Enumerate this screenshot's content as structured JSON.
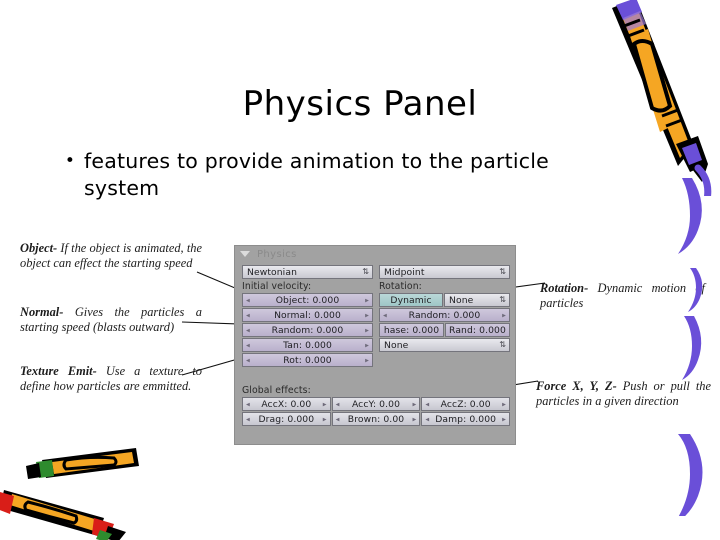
{
  "slide": {
    "title": "Physics Panel",
    "bullets": [
      {
        "marker": "•",
        "text": "features to provide animation to the particle system"
      }
    ]
  },
  "annotations": {
    "left": [
      {
        "name": "object",
        "term": "Object-",
        "body": "If the object is animated, the object can effect the starting speed"
      },
      {
        "name": "normal",
        "term": "Normal-",
        "body": "Gives the particles a starting speed (blasts  outward)"
      },
      {
        "name": "texture-emit",
        "term": "Texture Emit-",
        "body": "Use a texture to define how particles are emmitted."
      }
    ],
    "right": [
      {
        "name": "rotation",
        "term": "Rotation-",
        "body": "Dynamic motion of particles"
      },
      {
        "name": "force-xyz",
        "term": "Force X, Y, Z-",
        "body": "Push or pull the particles in a given direction"
      }
    ]
  },
  "physics_panel": {
    "header": {
      "title": "Physics",
      "collapse_icon": "triangle-down-icon"
    },
    "left_column": {
      "type_menu": {
        "value": "Newtonian",
        "arrows_icon": "updown-arrows-icon"
      },
      "section_label": "Initial velocity:",
      "sliders": [
        {
          "label": "Object: 0.000"
        },
        {
          "label": "Normal: 0.000"
        },
        {
          "label": "Random: 0.000"
        },
        {
          "label": "Tan: 0.000"
        },
        {
          "label": "Rot: 0.000"
        }
      ]
    },
    "right_column": {
      "integrator_menu": {
        "value": "Midpoint",
        "arrows_icon": "updown-arrows-icon"
      },
      "section_label": "Rotation:",
      "dynamic_toggle": {
        "label": "Dynamic",
        "active": true
      },
      "rotation_menu": {
        "value": "None",
        "arrows_icon": "updown-arrows-icon"
      },
      "random_slider": {
        "label": "Random: 0.000"
      },
      "phase_pair": [
        {
          "label": "hase: 0.000"
        },
        {
          "label": "Rand: 0.000"
        }
      ],
      "bottom_menu": {
        "value": "None",
        "arrows_icon": "updown-arrows-icon"
      }
    },
    "global_effects": {
      "section_label": "Global effects:",
      "row1": [
        {
          "label": "AccX: 0.00"
        },
        {
          "label": "AccY: 0.00"
        },
        {
          "label": "AccZ: 0.00"
        }
      ],
      "row2": [
        {
          "label": "Drag: 0.000"
        },
        {
          "label": "Brown: 0.00"
        },
        {
          "label": "Damp: 0.000"
        }
      ]
    },
    "arrow_icons": {
      "left": "◂",
      "right": "▸",
      "updown": "⇅"
    }
  },
  "decorations": {
    "crayon_top_right": {
      "name": "yellow-crayon-icon",
      "body_color": "#F5A623",
      "outline_color": "#000000",
      "tip_color": "#6A4FD8"
    },
    "crayons_bottom_left": {
      "name": "crossed-crayons-icon",
      "body_color": "#F5A623",
      "tip_color": "#D91E18",
      "accent_color": "#2E8B2E"
    },
    "swooshes": {
      "name": "purple-brush-stroke-icon",
      "color": "#6A4FD8",
      "count": 4
    }
  }
}
